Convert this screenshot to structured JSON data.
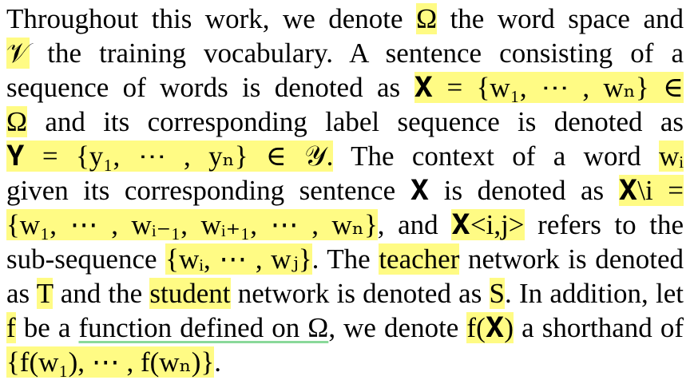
{
  "paragraph": {
    "lines": [
      {
        "justify": true,
        "segments": [
          {
            "text": "Throughout this work, we denote ",
            "style": "plain"
          },
          {
            "text": "Ω",
            "style": "hl"
          },
          {
            "text": " the word space and",
            "style": "plain"
          }
        ]
      },
      {
        "justify": true,
        "segments": [
          {
            "text": "𝒱",
            "style": "hl"
          },
          {
            "text": " the training vocabulary.  A sentence consisting of a",
            "style": "plain"
          }
        ]
      },
      {
        "justify": true,
        "segments": [
          {
            "text": "sequence of words is denoted as ",
            "style": "plain"
          },
          {
            "text": "𝐗 = {w₁, ⋯ , wₙ} ∈",
            "style": "hl"
          }
        ]
      },
      {
        "justify": true,
        "segments": [
          {
            "text": "Ω",
            "style": "hl"
          },
          {
            "text": " and its corresponding label sequence is denoted as",
            "style": "plain"
          }
        ]
      },
      {
        "justify": true,
        "segments": [
          {
            "text": "𝐘 = {y₁, ⋯ , yₙ} ∈ 𝒴.",
            "style": "hl"
          },
          {
            "text": "  The context of a word ",
            "style": "plain"
          },
          {
            "text": "wᵢ",
            "style": "hl"
          }
        ]
      },
      {
        "justify": true,
        "segments": [
          {
            "text": "given its corresponding sentence ",
            "style": "plain"
          },
          {
            "text": "𝐗",
            "style": "plain"
          },
          {
            "text": " is denoted as ",
            "style": "plain"
          },
          {
            "text": "𝐗\\i =",
            "style": "hl"
          }
        ]
      },
      {
        "justify": true,
        "segments": [
          {
            "text": "{w₁, ⋯ , wᵢ₋₁, wᵢ₊₁, ⋯ , wₙ}",
            "style": "hl"
          },
          {
            "text": ", and ",
            "style": "plain"
          },
          {
            "text": "𝐗<i,j>",
            "style": "hl"
          },
          {
            "text": " refers to the",
            "style": "plain"
          }
        ]
      },
      {
        "justify": true,
        "segments": [
          {
            "text": "sub-sequence ",
            "style": "plain"
          },
          {
            "text": "{wᵢ, ⋯ , wⱼ}",
            "style": "hl"
          },
          {
            "text": ". The ",
            "style": "plain"
          },
          {
            "text": "teacher",
            "style": "hl"
          },
          {
            "text": " network is denoted",
            "style": "plain"
          }
        ]
      },
      {
        "justify": true,
        "segments": [
          {
            "text": "as ",
            "style": "plain"
          },
          {
            "text": "T",
            "style": "hl"
          },
          {
            "text": " and the ",
            "style": "plain"
          },
          {
            "text": "student",
            "style": "hl"
          },
          {
            "text": " network is denoted as ",
            "style": "plain"
          },
          {
            "text": "S",
            "style": "hl"
          },
          {
            "text": ". In addition, let",
            "style": "plain"
          }
        ]
      },
      {
        "justify": true,
        "segments": [
          {
            "text": "f",
            "style": "hl"
          },
          {
            "text": " be a ",
            "style": "plain"
          },
          {
            "text": "function defined on Ω",
            "style": "ul"
          },
          {
            "text": ", we denote ",
            "style": "plain"
          },
          {
            "text": "f(𝐗)",
            "style": "hl"
          },
          {
            "text": " a shorthand of",
            "style": "plain"
          }
        ]
      },
      {
        "justify": false,
        "segments": [
          {
            "text": "{f(w₁), ⋯ , f(wₙ)}",
            "style": "hl"
          },
          {
            "text": ".",
            "style": "plain"
          }
        ]
      }
    ]
  },
  "colors": {
    "highlight": "#fffb84",
    "underline": "#8ad99a",
    "text": "#000000"
  }
}
